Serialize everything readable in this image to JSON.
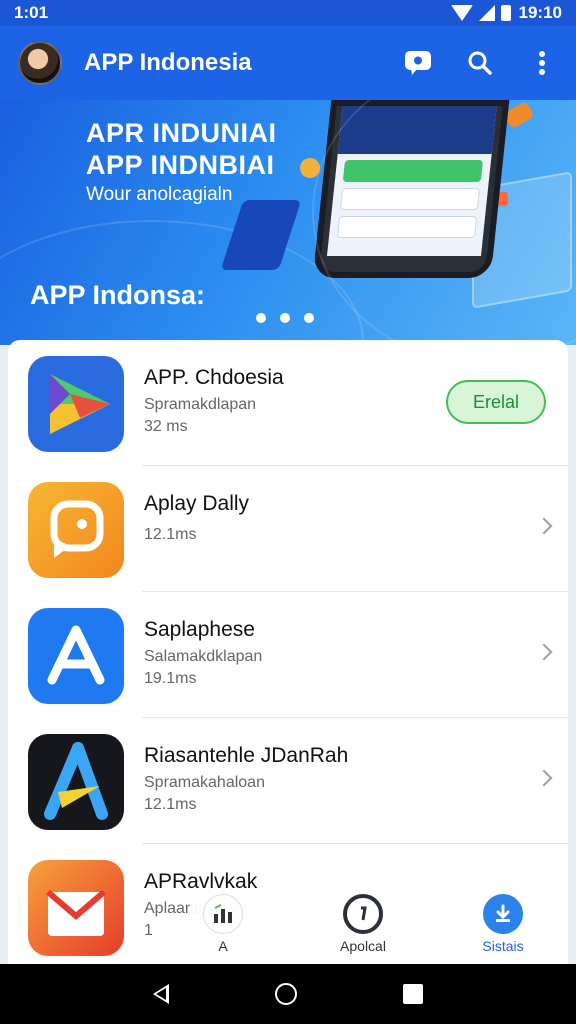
{
  "status_bar": {
    "left_text": "1:01",
    "time": "19:10"
  },
  "app_bar": {
    "title": "APP Indonesia",
    "icons": [
      "chat-icon",
      "search-icon",
      "more-vert-icon"
    ]
  },
  "banner": {
    "line1": "APR INDUNIAI",
    "line2": "APP INDNBIAI",
    "line3": "Wour anolcagialn",
    "line4": "APP Indonsa:",
    "dots": 3
  },
  "apps": [
    {
      "name": "APP. Chdoesia",
      "subtitle": "Spramakdlapan",
      "size": "32 ms",
      "action": "Erelal"
    },
    {
      "name": "Aplay Dally",
      "subtitle": "",
      "size": "12.1ms"
    },
    {
      "name": "Saplaphese",
      "subtitle": "Salamakdklapan",
      "size": "19.1ms"
    },
    {
      "name": "Riasantehle JDanRah",
      "subtitle": "Spramakahaloan",
      "size": "12.1ms"
    },
    {
      "name": "APRavlvkak",
      "subtitle": "Aplaantinra",
      "size": "1"
    }
  ],
  "bottom_nav": [
    {
      "label": "A",
      "icon": "chart-icon"
    },
    {
      "label": "Apolcal",
      "icon": "clock-icon"
    },
    {
      "label": "Sistais",
      "icon": "download-icon"
    }
  ],
  "colors": {
    "primary": "#1d63e6",
    "install_green": "#3fbf55"
  }
}
